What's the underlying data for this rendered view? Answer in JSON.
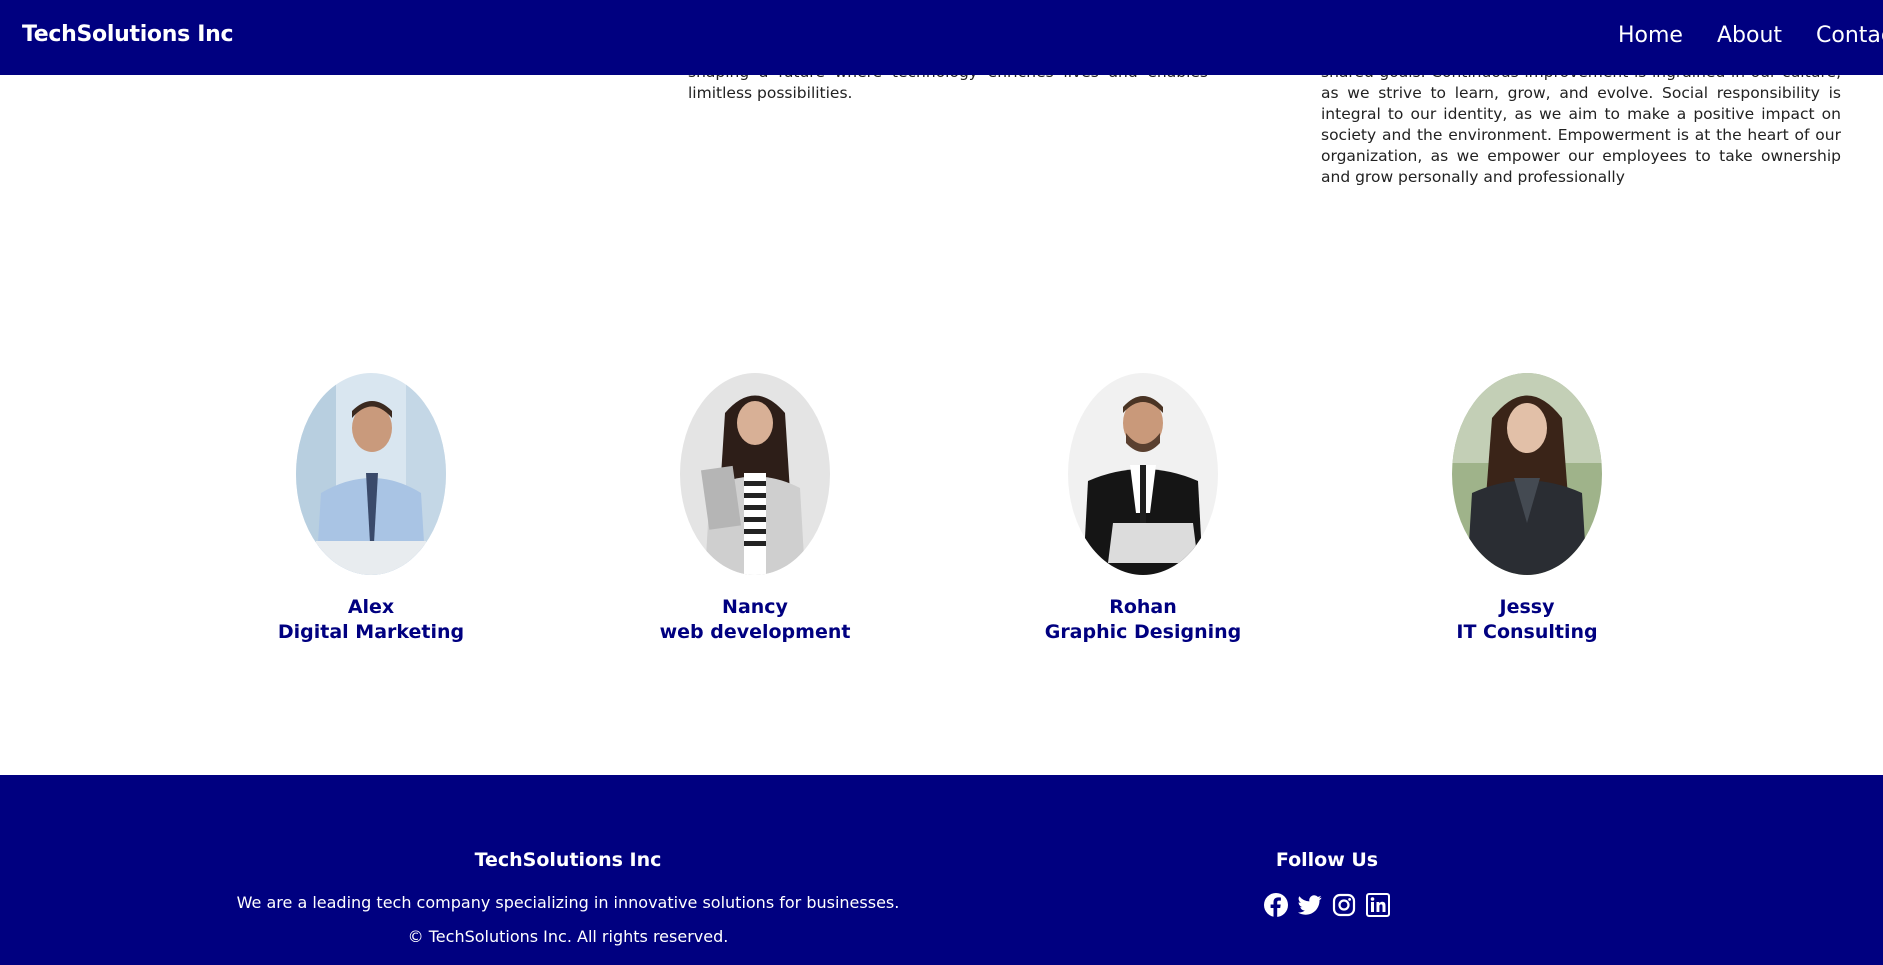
{
  "navbar": {
    "brand": "TechSolutions Inc",
    "links": [
      "Home",
      "About",
      "Contac"
    ]
  },
  "content": {
    "left_text": "shaping a future where technology enriches lives and enables limitless possibilities.",
    "right_text": "shared goals. Continuous improvement is ingrained in our culture, as we strive to learn, grow, and evolve. Social responsibility is integral to our identity, as we aim to make a positive impact on society and the environment. Empowerment is at the heart of our organization, as we empower our employees to take ownership and grow personally and professionally"
  },
  "team": [
    {
      "name": "Alex",
      "role": "Digital Marketing"
    },
    {
      "name": "Nancy",
      "role": "web development"
    },
    {
      "name": "Rohan",
      "role": "Graphic Designing"
    },
    {
      "name": "Jessy",
      "role": "IT Consulting"
    }
  ],
  "footer": {
    "title": "TechSolutions Inc",
    "description": "We are a leading tech company specializing in innovative solutions for businesses.",
    "copyright": "© TechSolutions Inc. All rights reserved.",
    "follow_title": "Follow Us",
    "social_icons": [
      "facebook-icon",
      "twitter-icon",
      "instagram-icon",
      "linkedin-icon"
    ]
  },
  "colors": {
    "primary": "#000080",
    "background": "#ffffff",
    "text": "#222222"
  }
}
